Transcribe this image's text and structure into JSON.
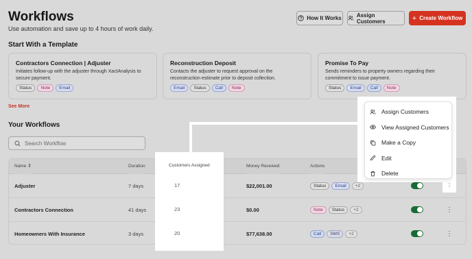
{
  "header": {
    "title": "Workflows",
    "subtitle": "Use automation and save up to 4 hours of work daily.",
    "how_label": "How It Works",
    "assign_label": "Assign Customers",
    "create_label": "Create Workflow"
  },
  "templates": {
    "heading": "Start With a Template",
    "see_more": "See More",
    "cards": [
      {
        "title": "Contractors Connection | Adjuster",
        "desc": "Initiates follow-up with the adjuster through XactAnalysis to secure payment.",
        "tags": [
          "Status",
          "Note",
          "Email"
        ]
      },
      {
        "title": "Reconstruction Deposit",
        "desc": "Contacts the adjuster to request approval on the reconstruction estimate prior to deposit collection.",
        "tags": [
          "Email",
          "Status",
          "Call",
          "Note"
        ]
      },
      {
        "title": "Promise To Pay",
        "desc": "Sends reminders to property owners regarding their commitment to issue payment.",
        "tags": [
          "Status",
          "Email",
          "Call",
          "Note"
        ]
      }
    ]
  },
  "workflows": {
    "heading": "Your Workflows",
    "search_placeholder": "Search Workflow",
    "columns": {
      "name": "Name",
      "duration": "Duration",
      "customers": "Customers Assigned",
      "money": "Money Received",
      "actions": "Actions"
    },
    "rows": [
      {
        "name": "Adjuster",
        "duration": "7 days",
        "customers": "17",
        "money": "$22,001.00",
        "tags": [
          "Email"
        ],
        "first_tag": "Status",
        "more": "+2",
        "enabled": true
      },
      {
        "name": "Contractors Connection",
        "duration": "41 days",
        "customers": "23",
        "money": "$0.00",
        "first_tag": "Note",
        "tags": [
          "Status"
        ],
        "more": "+2",
        "enabled": true
      },
      {
        "name": "Homeowners With Insurance",
        "duration": "3 days",
        "customers": "20",
        "money": "$77,638.00",
        "first_tag": "Call",
        "tags": [
          "SMS"
        ],
        "more": "+2",
        "enabled": true
      }
    ]
  },
  "menu": {
    "items": [
      {
        "label": "Assign Customers",
        "icon": "users-icon"
      },
      {
        "label": "View Assigned Customers",
        "icon": "eye-icon"
      },
      {
        "label": "Make a Copy",
        "icon": "copy-icon"
      },
      {
        "label": "Edit",
        "icon": "pencil-icon"
      },
      {
        "label": "Delete",
        "icon": "trash-icon"
      }
    ]
  },
  "colors": {
    "brand_red": "#d5321f",
    "toggle_on": "#186a35"
  }
}
